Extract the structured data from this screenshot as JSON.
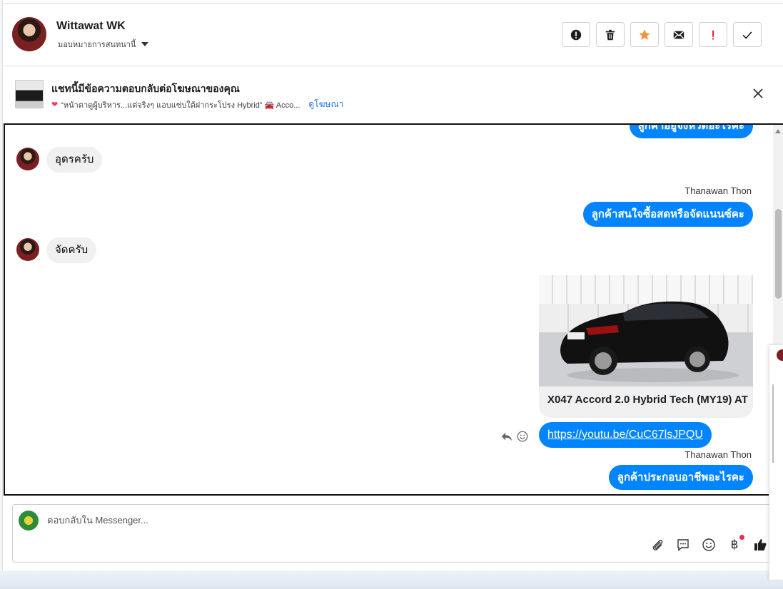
{
  "header": {
    "contact_name": "Wittawat WK",
    "assign_label": "มอบหมายการสนทนานี้"
  },
  "ad_banner": {
    "title": "แชทนี้มีข้อความตอบกลับต่อโฆษณาของคุณ",
    "snippet": "“หน้าตาดูผู้บริหาร...แต่จริงๆ แอบแซ่บใต้ฝากระโปรง Hybrid” 🚘 Acco...",
    "view_ad_link": "ดูโฆษณา"
  },
  "messages": {
    "top_partial": "ลูกค้าอยู่จังหวัดอะไรคะ",
    "msg1": "อุดรครับ",
    "sender1": "Thanawan Thon",
    "msg2": "ลูกค้าสนใจซื้อสดหรือจัดแนนซ์คะ",
    "msg3": "จัดครับ",
    "card_title": "X047 Accord 2.0 Hybrid Tech (MY19) AT",
    "link": "https://youtu.be/CuC67lsJPQU",
    "sender2": "Thanawan Thon",
    "msg4": "ลูกค้าประกอบอาชีพอะไรคะ"
  },
  "composer": {
    "placeholder": "ตอบกลับใน Messenger...",
    "baht_symbol": "฿"
  },
  "icons": {
    "toolbar": [
      "alert-circle-icon",
      "trash-icon",
      "star-icon",
      "mail-icon",
      "exclamation-icon",
      "check-icon"
    ],
    "star_color": "#f7923a",
    "exclamation_color": "#e02020",
    "bubble_color": "#0084ff"
  }
}
